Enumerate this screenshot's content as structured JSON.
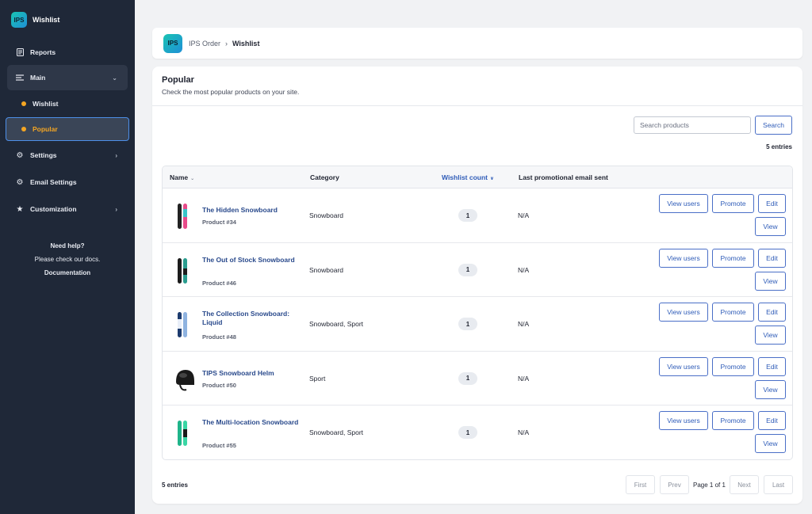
{
  "app": {
    "logo_text": "IPS",
    "name": "Wishlist"
  },
  "sidebar": {
    "items": [
      {
        "id": "reports",
        "label": "Reports",
        "icon": "document-icon"
      },
      {
        "id": "main",
        "label": "Main",
        "icon": "lines-icon"
      },
      {
        "id": "settings",
        "label": "Settings",
        "icon": "gear-icon"
      },
      {
        "id": "email",
        "label": "Email Settings",
        "icon": "gear-icon"
      },
      {
        "id": "custom",
        "label": "Customization",
        "icon": "star-icon"
      }
    ],
    "sub_items": [
      {
        "label": "Wishlist"
      },
      {
        "label": "Popular"
      }
    ],
    "help": {
      "title": "Need help?",
      "text": "Please check our docs.",
      "link": "Documentation"
    }
  },
  "breadcrumb": {
    "root": "IPS Order",
    "separator": "›",
    "current": "Wishlist"
  },
  "page": {
    "title": "Popular",
    "subtitle": "Check the most popular products on your site.",
    "search_placeholder": "Search products",
    "search_button": "Search",
    "entries_label": "5 entries"
  },
  "table": {
    "headers": {
      "name": "Name",
      "category": "Category",
      "wishlist": "Wishlist count",
      "last_email": "Last promotional email sent"
    },
    "rows": [
      {
        "name": "The Hidden Snowboard",
        "id": "Product #34",
        "category": "Snowboard",
        "count": "1",
        "last": "N/A",
        "thumb": "board-pink"
      },
      {
        "name": "The Out of Stock Snowboard",
        "id": "Product #46",
        "category": "Snowboard",
        "count": "1",
        "last": "N/A",
        "thumb": "board-teal"
      },
      {
        "name": "The Collection Snowboard: Liquid",
        "id": "Product #48",
        "category": "Snowboard, Sport",
        "count": "1",
        "last": "N/A",
        "thumb": "board-blue"
      },
      {
        "name": "TIPS Snowboard Helm",
        "id": "Product #50",
        "category": "Sport",
        "count": "1",
        "last": "N/A",
        "thumb": "helmet"
      },
      {
        "name": "The Multi-location Snowboard",
        "id": "Product #55",
        "category": "Snowboard, Sport",
        "count": "1",
        "last": "N/A",
        "thumb": "board-green"
      }
    ],
    "actions": {
      "view_users": "View users",
      "promote": "Promote",
      "edit": "Edit",
      "view": "View"
    }
  },
  "pagination": {
    "first": "First",
    "prev": "Prev",
    "text": "Page 1 of 1",
    "next": "Next",
    "last": "Last"
  },
  "colors": {
    "sidebar_bg": "#1f2838",
    "accent": "#f5a623",
    "link": "#2f5cb8",
    "focus_border": "#4d8fe8"
  }
}
